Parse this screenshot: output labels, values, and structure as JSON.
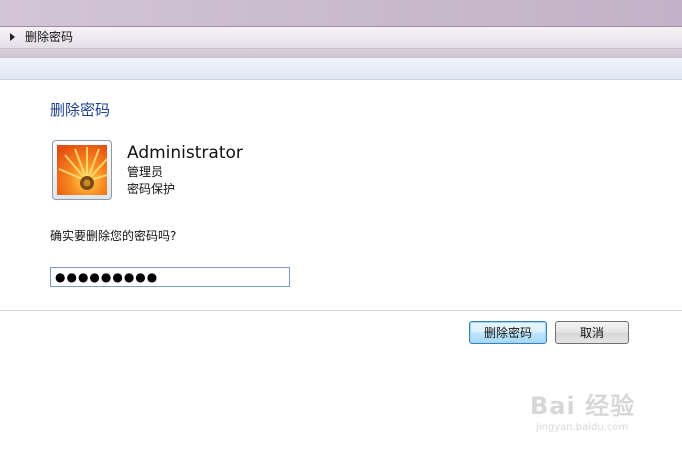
{
  "breadcrumb": {
    "label": "删除密码"
  },
  "page": {
    "heading": "删除密码"
  },
  "user": {
    "name": "Administrator",
    "role": "管理员",
    "status": "密码保护",
    "avatar_icon": "flower-avatar-icon"
  },
  "form": {
    "prompt": "确实要删除您的密码吗?",
    "password_value": "●●●●●●●●●"
  },
  "buttons": {
    "delete_label": "删除密码",
    "cancel_label": "取消"
  },
  "watermark": {
    "brand": "Bai 经验",
    "url": "jingyan.baidu.com"
  },
  "colors": {
    "heading": "#1e3f8f",
    "titlebar": "#ccbccf",
    "commandbar": "#e6edf7",
    "primary_button_border": "#3c7fb1"
  }
}
